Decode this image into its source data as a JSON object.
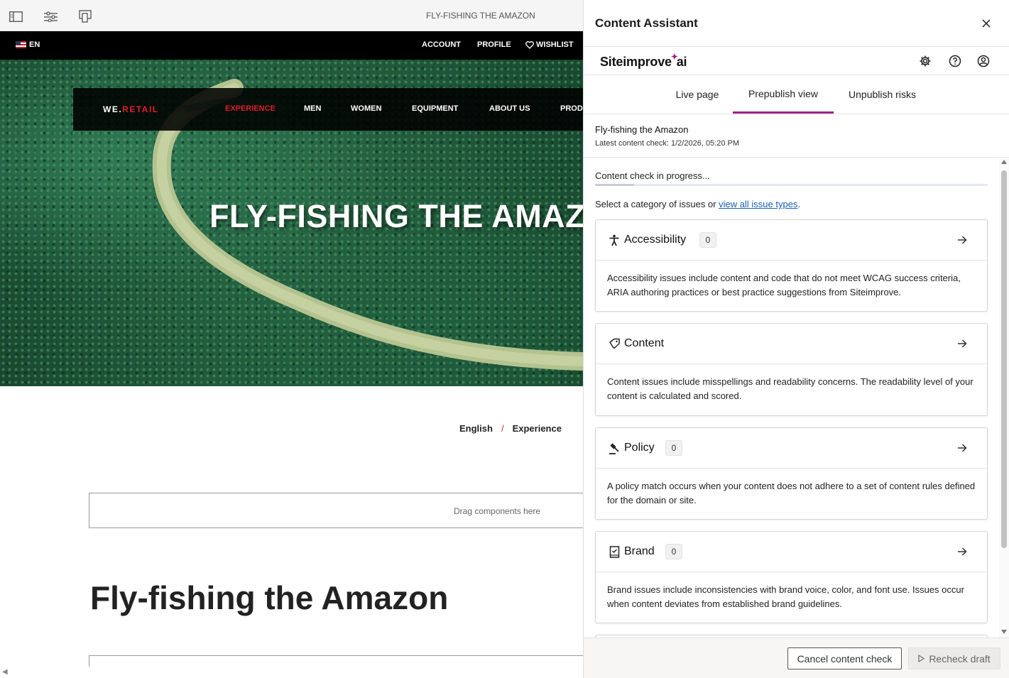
{
  "editor": {
    "page_title": "FLY-FISHING THE AMAZON",
    "site": {
      "language": "EN",
      "top_links": [
        "ACCOUNT",
        "PROFILE",
        "WISHLIST"
      ],
      "brand_prefix": "WE.",
      "brand_suffix": "RETAIL",
      "nav": [
        "EXPERIENCE",
        "MEN",
        "WOMEN",
        "EQUIPMENT",
        "ABOUT US",
        "PROD"
      ],
      "hero_title": "FLY-FISHING THE AMAZ",
      "breadcrumb": [
        "English",
        "Experience"
      ],
      "breadcrumb_sep": "/",
      "dropzone_label": "Drag components here",
      "article_title": "Fly-fishing the Amazon"
    }
  },
  "panel": {
    "title": "Content Assistant",
    "logo_text_a": "Siteimprove",
    "logo_spark": "✦",
    "logo_text_b": "ai",
    "tabs": [
      {
        "label": "Live page",
        "active": false
      },
      {
        "label": "Prepublish view",
        "active": true
      },
      {
        "label": "Unpublish risks",
        "active": false
      }
    ],
    "page_name": "Fly-fishing the Amazon",
    "last_check": "Latest content check: 1/2/2026, 05:20 PM",
    "progress_text": "Content check in progress...",
    "progress_fraction": 0.1,
    "select_prefix": "Select a category of issues or ",
    "select_link": "view all issue types",
    "select_suffix": ".",
    "cards": [
      {
        "title": "Accessibility",
        "count": "0",
        "icon": "accessibility-icon",
        "desc": "Accessibility issues include content and code that do not meet WCAG success criteria, ARIA authoring practices or best practice suggestions from Siteimprove."
      },
      {
        "title": "Content",
        "count": "",
        "icon": "content-tag-icon",
        "desc": "Content issues include misspellings and readability concerns. The readability level of your content is calculated and scored."
      },
      {
        "title": "Policy",
        "count": "0",
        "icon": "gavel-icon",
        "desc": "A policy match occurs when your content does not adhere to a set of content rules defined for the domain or site."
      },
      {
        "title": "Brand",
        "count": "0",
        "icon": "brand-book-icon",
        "desc": "Brand issues include inconsistencies with brand voice, color, and font use. Issues occur when content deviates from established brand guidelines."
      }
    ],
    "cancel_label": "Cancel content check",
    "recheck_label": "Recheck draft",
    "accent_color": "#a0208c",
    "link_color": "#1a5fb4"
  }
}
